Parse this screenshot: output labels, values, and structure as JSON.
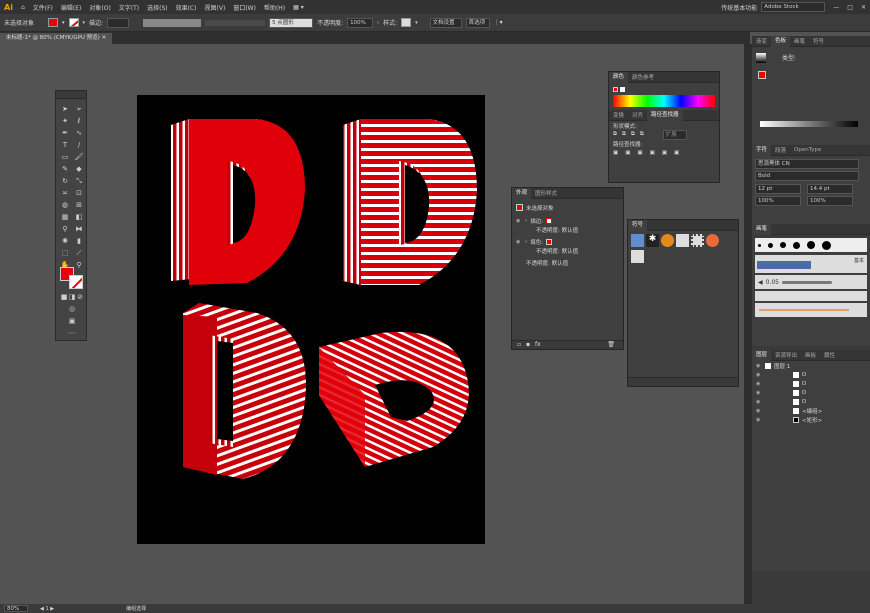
{
  "menubar": {
    "logo": "Ai",
    "items": [
      "文件(F)",
      "编辑(E)",
      "对象(O)",
      "文字(T)",
      "选择(S)",
      "效果(C)",
      "视图(V)",
      "窗口(W)",
      "帮助(H)"
    ],
    "workspace": "传统基本功能",
    "search_placeholder": "Adobe Stock"
  },
  "control_bar": {
    "selection_label": "未选择对象",
    "stroke_label": "描边:",
    "brush_value": "5 点圆形",
    "opacity_label": "不透明度:",
    "opacity_value": "100%",
    "style_label": "样式:",
    "doc_setup": "文档设置",
    "prefs": "首选项",
    "fill_color": "#e8000a"
  },
  "document_tab": {
    "title": "未标题-1* @ 80% (CMYK/GPU 预览)"
  },
  "status_bar": {
    "zoom": "80%",
    "page": "1",
    "tool": "编组选择"
  },
  "canvas": {
    "artboard_color": "#000000",
    "accent_red": "#e0000a",
    "letter": "D"
  },
  "color_panel": {
    "tabs": [
      "颜色",
      "颜色参考"
    ]
  },
  "pathfinder_panel": {
    "tabs": [
      "变换",
      "对齐",
      "路径查找器"
    ],
    "shape_modes_label": "形状模式:",
    "pathfinders_label": "路径查找器:",
    "expand_button": "扩展"
  },
  "appearance_panel": {
    "tabs": [
      "外观",
      "图形样式"
    ],
    "title": "未选择对象",
    "stroke_label": "描边:",
    "stroke_opacity": "不透明度: 默认值",
    "fill_label": "填色:",
    "fill_opacity": "不透明度: 默认值",
    "opacity": "不透明度: 默认值"
  },
  "symbols_panel": {
    "tabs": [
      "符号"
    ]
  },
  "right_dock": {
    "top_tabs": [
      "渐变",
      "色板",
      "画笔",
      "符号"
    ],
    "type_label": "类型:",
    "char_tabs": [
      "字符",
      "段落",
      "OpenType"
    ],
    "font_name": "思源黑体 CN",
    "font_style": "Bold",
    "font_size": "12 pt",
    "leading": "14.4 pt",
    "tracking": "0",
    "scale_v": "100%",
    "scale_h": "100%",
    "brush_tab": "画笔",
    "brush_size_label": "基本",
    "brush_value": "0.05",
    "layers_tabs": [
      "图层",
      "资源导出",
      "画板",
      "属性"
    ],
    "layers": [
      {
        "name": "图层 1",
        "indent": 0
      },
      {
        "name": "D",
        "indent": 1
      },
      {
        "name": "D",
        "indent": 1
      },
      {
        "name": "D",
        "indent": 1
      },
      {
        "name": "D",
        "indent": 1
      },
      {
        "name": "<编组>",
        "indent": 1
      },
      {
        "name": "<矩形>",
        "indent": 1
      }
    ]
  }
}
